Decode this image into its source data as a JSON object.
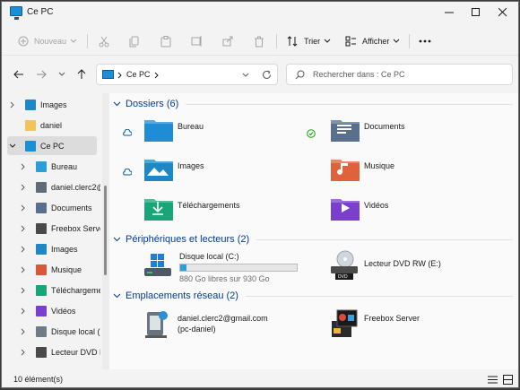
{
  "window": {
    "title": "Ce PC"
  },
  "toolbar": {
    "new_label": "Nouveau",
    "sort_label": "Trier",
    "view_label": "Afficher"
  },
  "address": {
    "location": "Ce PC",
    "search_placeholder": "Rechercher dans : Ce PC"
  },
  "sidebar": {
    "items": [
      {
        "label": "Images",
        "icon": "images-icon",
        "color": "#1e88c7"
      },
      {
        "label": "daniel",
        "icon": "user-folder-icon",
        "color": "#f2c35a"
      },
      {
        "label": "Ce PC",
        "icon": "this-pc-icon",
        "color": "#1a8fd6"
      },
      {
        "label": "Bureau",
        "icon": "desktop-icon",
        "color": "#2a9fd8"
      },
      {
        "label": "daniel.clerc2@",
        "icon": "network-drive-icon",
        "color": "#606b78"
      },
      {
        "label": "Documents",
        "icon": "documents-icon",
        "color": "#5a6f8c"
      },
      {
        "label": "Freebox Serve",
        "icon": "media-server-icon",
        "color": "#4a4a4a"
      },
      {
        "label": "Images",
        "icon": "images-icon",
        "color": "#1e88c7"
      },
      {
        "label": "Musique",
        "icon": "music-icon",
        "color": "#d9573a"
      },
      {
        "label": "Téléchargeme",
        "icon": "downloads-icon",
        "color": "#18a578"
      },
      {
        "label": "Vidéos",
        "icon": "videos-icon",
        "color": "#7b3fd0"
      },
      {
        "label": "Disque local (C",
        "icon": "drive-icon",
        "color": "#6f7b86"
      },
      {
        "label": "Lecteur DVD R",
        "icon": "dvd-drive-icon",
        "color": "#4a4a4a"
      }
    ]
  },
  "groups": {
    "folders": "Dossiers (6)",
    "devices": "Périphériques et lecteurs (2)",
    "network": "Emplacements réseau (2)"
  },
  "folders": [
    {
      "label": "Bureau",
      "icon": "desktop-folder-icon",
      "color": "#1f8dd6"
    },
    {
      "label": "Documents",
      "icon": "documents-folder-icon",
      "color": "#5a6f8c"
    },
    {
      "label": "Images",
      "icon": "pictures-folder-icon",
      "color": "#1e88c7"
    },
    {
      "label": "Musique",
      "icon": "music-folder-icon",
      "color": "#e0623c"
    },
    {
      "label": "Téléchargements",
      "icon": "downloads-folder-icon",
      "color": "#18a578"
    },
    {
      "label": "Vidéos",
      "icon": "videos-folder-icon",
      "color": "#7b3fd0"
    }
  ],
  "devices": [
    {
      "label": "Disque local (C:)",
      "info": "880 Go libres sur 930 Go",
      "used_fraction": 0.054,
      "icon": "windows-drive-icon"
    },
    {
      "label": "Lecteur DVD RW (E:)",
      "icon": "dvd-drive-icon",
      "badge": "DVD"
    }
  ],
  "network": [
    {
      "label_line1": "daniel.clerc2@gmail.com",
      "label_line2": "(pc-daniel)",
      "icon": "network-share-icon"
    },
    {
      "label_line1": "Freebox Server",
      "icon": "media-server-icon"
    }
  ],
  "status": {
    "count": "10 élément(s)"
  },
  "colors": {
    "accent": "#005fb8",
    "group_heading": "#003e92",
    "sync_ok": "#13a10e"
  }
}
